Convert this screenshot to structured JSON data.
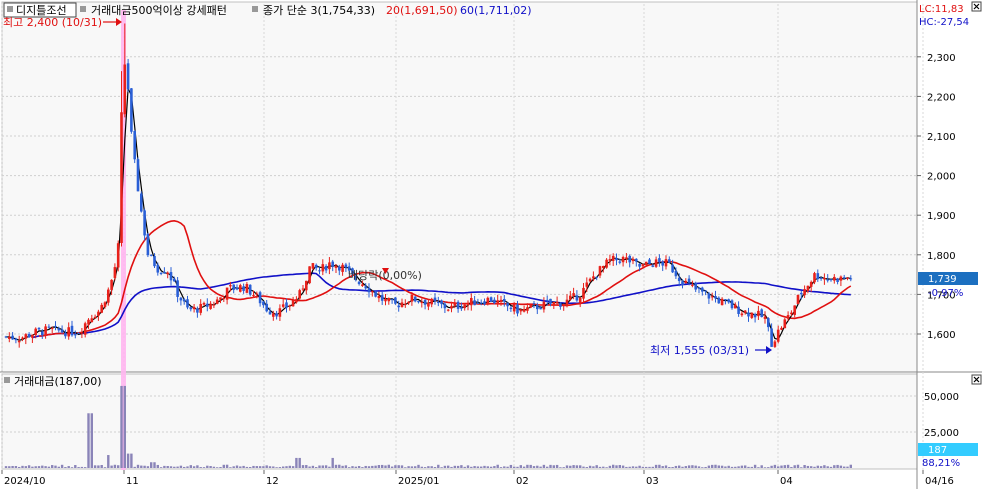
{
  "header": {
    "stock_name": "디지틀조선",
    "condition": "거래대금500억이상 강세패턴",
    "ma_labels": [
      {
        "text": "종가 단순 3(1,754,33)",
        "color": "#000000"
      },
      {
        "text": "20(1,691,50)",
        "color": "#e01010"
      },
      {
        "text": "60(1,711,02)",
        "color": "#1010c8"
      }
    ],
    "lc": "LC:11,83",
    "hc": "HC:-27,54"
  },
  "annotations": {
    "high": "최고 2,400 (10/31)",
    "low": "최저 1,555 (03/31)",
    "dividend": "배당락(0,00%)"
  },
  "price_axis": {
    "current_price": "1,739",
    "change_pct": "-0,97%"
  },
  "volume_panel": {
    "label": "거래대금(187,00)",
    "current": "187",
    "pct": "88,21%"
  },
  "colors": {
    "up": "#e8211b",
    "down": "#2a5fd6",
    "ma3": "#000000",
    "ma20": "#e01010",
    "ma60": "#1010c8",
    "volume": "#8a84b8",
    "highlight": "#ffb6ef",
    "current_box": "#1c6fc0",
    "volume_box": "#33ccff"
  },
  "chart_data": [
    {
      "type": "candlestick",
      "title": "디지틀조선",
      "y_ticks": [
        1600,
        1700,
        1800,
        1900,
        2000,
        2100,
        2200,
        2300
      ],
      "ylim": [
        1530,
        2450
      ],
      "x_ticks": [
        "2024/10",
        "11",
        "12",
        "2025/01",
        "02",
        "03",
        "04",
        "04/16"
      ],
      "high": {
        "value": 2400,
        "date": "10/31"
      },
      "low": {
        "value": 1555,
        "date": "03/31"
      },
      "current": 1739,
      "series": [
        {
          "name": "종가 단순 3",
          "last": 1754.33
        },
        {
          "name": "20",
          "last": 1691.5
        },
        {
          "name": "60",
          "last": 1711.02
        }
      ],
      "grid": true
    },
    {
      "type": "bar",
      "title": "거래대금",
      "y_ticks": [
        25000,
        50000
      ],
      "ylim": [
        0,
        65000
      ],
      "current": 187
    }
  ]
}
